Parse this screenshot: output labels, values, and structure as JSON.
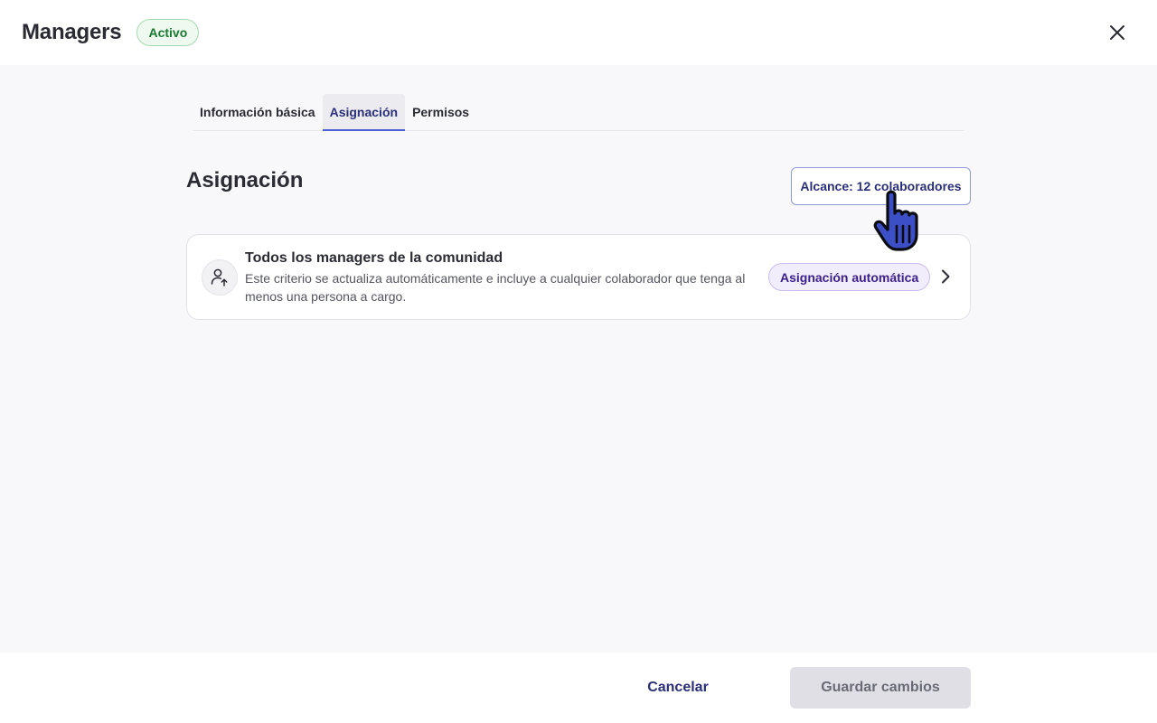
{
  "header": {
    "title": "Managers",
    "status": "Activo"
  },
  "tabs": [
    {
      "label": "Información básica",
      "active": false
    },
    {
      "label": "Asignación",
      "active": true
    },
    {
      "label": "Permisos",
      "active": false
    }
  ],
  "section": {
    "title": "Asignación",
    "scope_button": "Alcance: 12 colaboradores"
  },
  "criteria": {
    "title": "Todos los managers de la comunidad",
    "description": "Este criterio se actualiza automáticamente e incluye a cualquier colaborador que tenga al menos una persona a cargo.",
    "badge": "Asignación automática",
    "icon": "user-arrow-up-icon"
  },
  "footer": {
    "cancel_label": "Cancelar",
    "save_label": "Guardar cambios"
  },
  "colors": {
    "accent": "#2a2f7a",
    "tab_indicator": "#4a5fd6",
    "status_green": "#1a7a32",
    "badge_purple": "#3b1f8a"
  }
}
